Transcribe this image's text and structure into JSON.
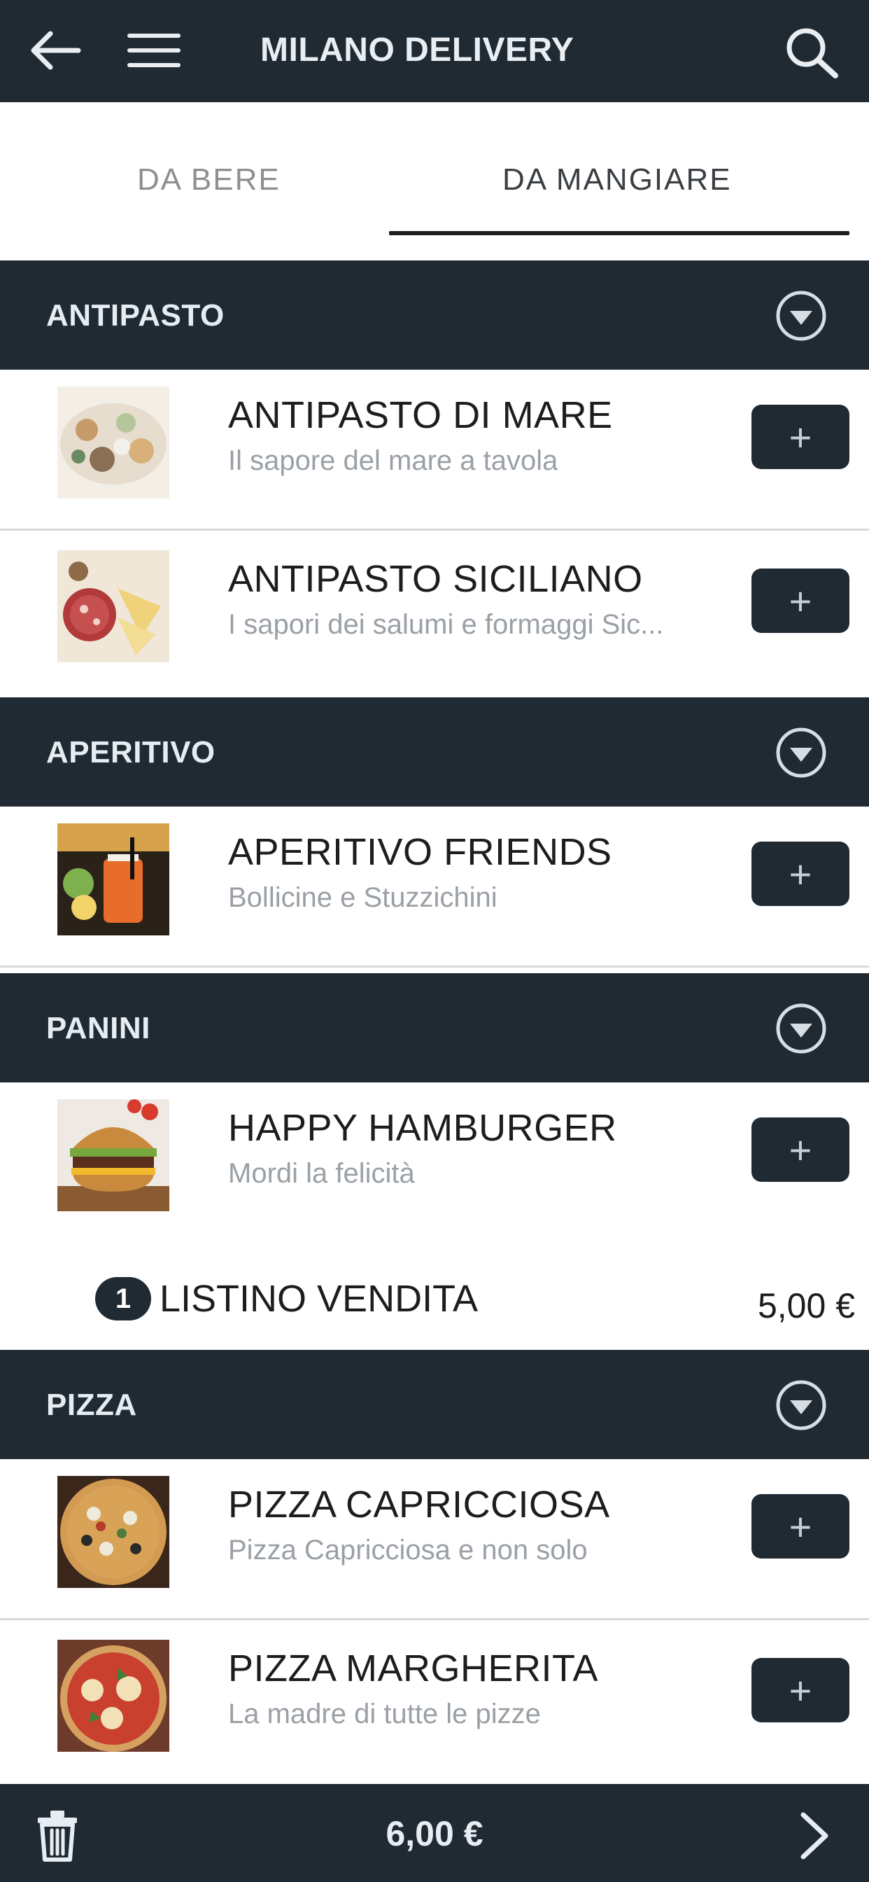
{
  "header": {
    "title": "MILANO DELIVERY"
  },
  "tabs": [
    {
      "label": "DA BERE",
      "active": false
    },
    {
      "label": "DA MANGIARE",
      "active": true
    }
  ],
  "categories": [
    {
      "label": "ANTIPASTO",
      "items": [
        {
          "name": "ANTIPASTO DI MARE",
          "desc": "Il sapore del mare a tavola",
          "image": "seafood-antipasto-image"
        },
        {
          "name": "ANTIPASTO SICILIANO",
          "desc": "I sapori dei salumi e formaggi Sic...",
          "image": "cured-meats-cheese-image"
        }
      ]
    },
    {
      "label": "APERITIVO",
      "items": [
        {
          "name": "APERITIVO FRIENDS",
          "desc": "Bollicine e Stuzzichini",
          "image": "aperitivo-drinks-image"
        }
      ]
    },
    {
      "label": "PANINI",
      "items": [
        {
          "name": "HAPPY HAMBURGER",
          "desc": "Mordi la felicità",
          "image": "hamburger-image"
        }
      ],
      "listino": {
        "qty": "1",
        "label": "LISTINO VENDITA",
        "price": "5,00 €"
      }
    },
    {
      "label": "PIZZA",
      "items": [
        {
          "name": "PIZZA CAPRICCIOSA",
          "desc": "Pizza Capricciosa e non solo",
          "image": "pizza-capricciosa-image"
        },
        {
          "name": "PIZZA MARGHERITA",
          "desc": "La madre di tutte le pizze",
          "image": "pizza-margherita-image"
        }
      ]
    }
  ],
  "footer": {
    "total": "6,00 €"
  },
  "icons": {
    "back": "back-arrow-icon",
    "menu": "hamburger-menu-icon",
    "search": "search-icon",
    "toggle": "chevron-down-circle-icon",
    "add": "plus-icon",
    "trash": "trash-icon",
    "next": "chevron-right-icon"
  },
  "colors": {
    "bar": "#1f2a33",
    "muted": "#9aa0a6"
  }
}
